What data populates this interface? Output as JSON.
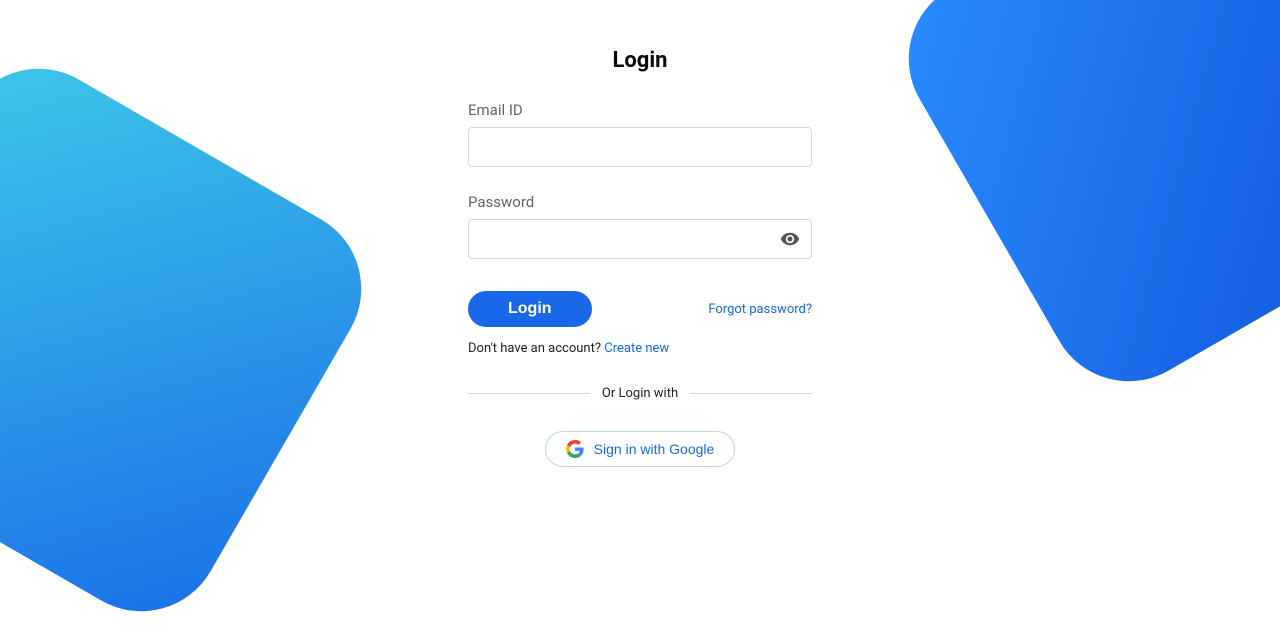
{
  "title": "Login",
  "email": {
    "label": "Email ID",
    "value": ""
  },
  "password": {
    "label": "Password",
    "value": ""
  },
  "buttons": {
    "login": "Login",
    "forgot": "Forgot password?",
    "google": "Sign in with Google"
  },
  "signup": {
    "prompt": "Don't have an account? ",
    "link": "Create new"
  },
  "divider": "Or Login with"
}
